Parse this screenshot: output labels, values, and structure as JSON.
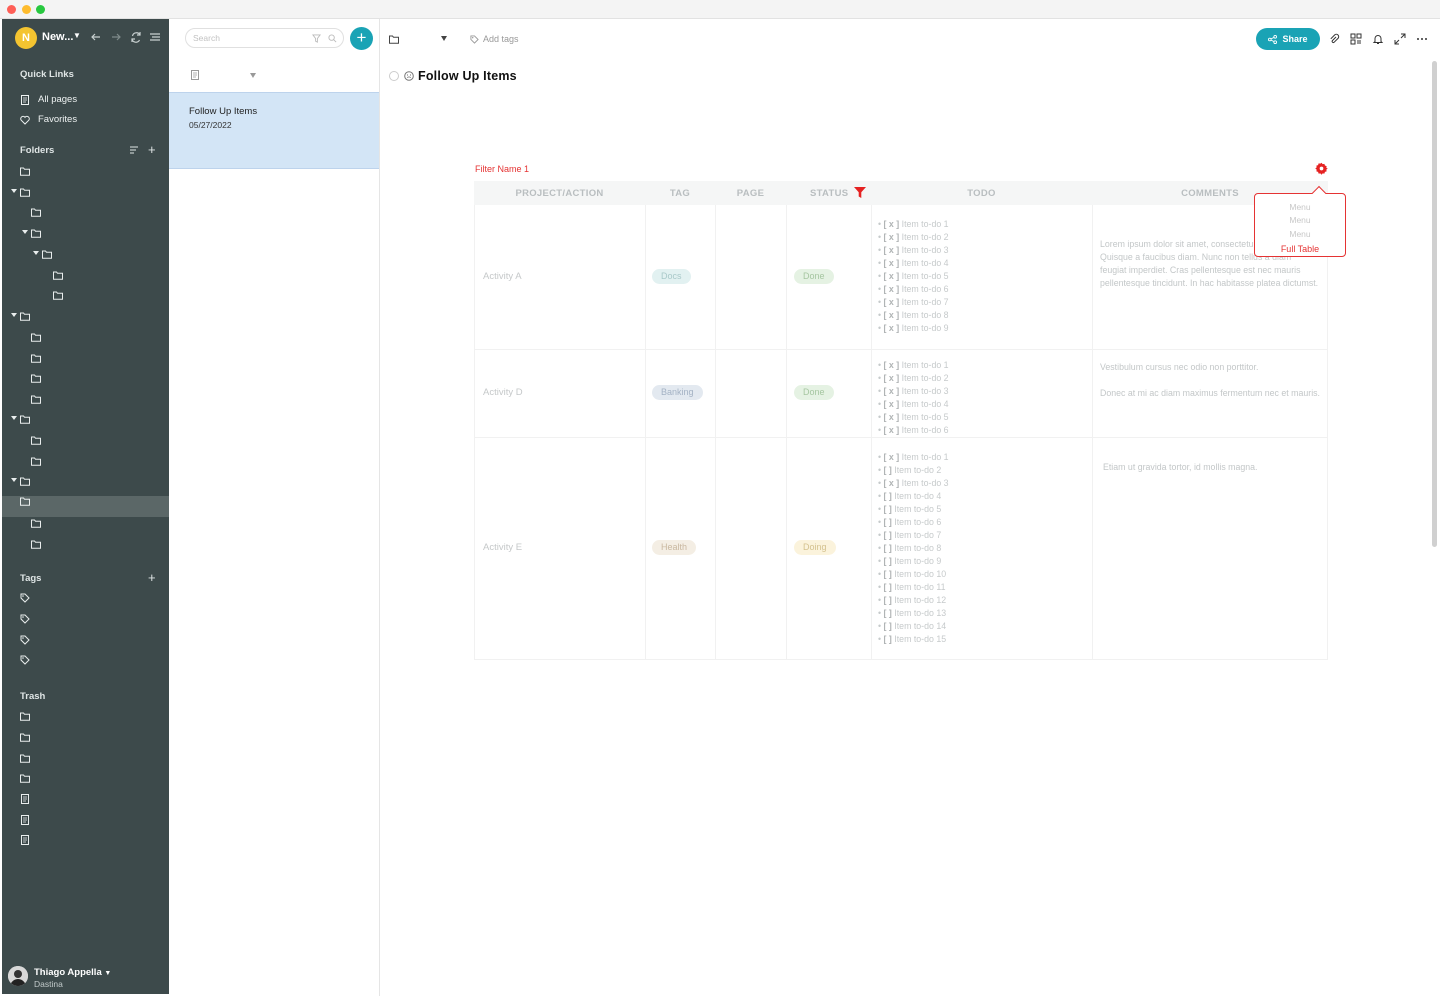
{
  "app": {
    "workspace_initial": "N",
    "workspace_name": "New...",
    "colors": {
      "sidebar": "#3d4a4b",
      "accent": "#1aa3b5",
      "selection": "#d3e5f6",
      "filter_red": "#e53333"
    }
  },
  "sidebar": {
    "quick_links_title": "Quick Links",
    "quick_links": [
      {
        "label": "All pages",
        "icon": "page-icon"
      },
      {
        "label": "Favorites",
        "icon": "heart-icon"
      }
    ],
    "folders_title": "Folders",
    "tags_title": "Tags",
    "trash_title": "Trash",
    "user_name": "Thiago Appella",
    "user_sub": "Dastina"
  },
  "list": {
    "search_placeholder": "Search",
    "note": {
      "title": "Follow Up Items",
      "date": "05/27/2022"
    }
  },
  "editor": {
    "add_tags": "Add tags",
    "share_label": "Share",
    "page_title": "Follow Up Items"
  },
  "table": {
    "filter_name": "Filter Name 1",
    "headers": [
      "PROJECT/ACTION",
      "TAG",
      "PAGE",
      "STATUS",
      "TODO",
      "COMMENTS"
    ],
    "rows": [
      {
        "action": "Activity A",
        "tag": "Docs",
        "status": "Done",
        "todos": [
          {
            "mark": "[ x ]",
            "text": "Item to-do 1"
          },
          {
            "mark": "[ x ]",
            "text": "Item to-do 2"
          },
          {
            "mark": "[ x ]",
            "text": "Item to-do 3"
          },
          {
            "mark": "[ x ]",
            "text": "Item to-do 4"
          },
          {
            "mark": "[ x ]",
            "text": "Item to-do 5"
          },
          {
            "mark": "[ x ]",
            "text": "Item to-do 6"
          },
          {
            "mark": "[ x ]",
            "text": "Item to-do 7"
          },
          {
            "mark": "[ x ]",
            "text": "Item to-do 8"
          },
          {
            "mark": "[ x ]",
            "text": "Item to-do 9"
          }
        ],
        "comments": [
          "Lorem ipsum dolor sit amet, consectetur adipiscing elit. Quisque a faucibus diam. Nunc non tellus a diam feugiat imperdiet. Cras pellentesque est nec mauris pellentesque tincidunt. In hac habitasse platea dictumst."
        ]
      },
      {
        "action": "Activity D",
        "tag": "Banking",
        "status": "Done",
        "todos": [
          {
            "mark": "[ x ]",
            "text": "Item to-do 1"
          },
          {
            "mark": "[ x ]",
            "text": "Item to-do 2"
          },
          {
            "mark": "[ x ]",
            "text": "Item to-do 3"
          },
          {
            "mark": "[ x ]",
            "text": "Item to-do 4"
          },
          {
            "mark": "[ x ]",
            "text": "Item to-do 5"
          },
          {
            "mark": "[ x ]",
            "text": "Item to-do 6"
          }
        ],
        "comments": [
          "Vestibulum cursus nec odio non porttitor.",
          "Donec at mi ac diam maximus fermentum nec et mauris."
        ]
      },
      {
        "action": "Activity E",
        "tag": "Health",
        "status": "Doing",
        "todos": [
          {
            "mark": "[ x ]",
            "text": "Item to-do 1"
          },
          {
            "mark": "[   ]",
            "text": "Item to-do 2"
          },
          {
            "mark": "[ x ]",
            "text": "Item to-do 3"
          },
          {
            "mark": "[   ]",
            "text": "Item to-do 4"
          },
          {
            "mark": "[   ]",
            "text": "Item to-do 5"
          },
          {
            "mark": "[   ]",
            "text": "Item to-do 6"
          },
          {
            "mark": "[   ]",
            "text": "Item to-do 7"
          },
          {
            "mark": "[   ]",
            "text": "Item to-do 8"
          },
          {
            "mark": "[   ]",
            "text": "Item to-do 9"
          },
          {
            "mark": "[   ]",
            "text": "Item to-do 10"
          },
          {
            "mark": "[   ]",
            "text": "Item to-do 11"
          },
          {
            "mark": "[   ]",
            "text": "Item to-do 12"
          },
          {
            "mark": "[   ]",
            "text": "Item to-do 13"
          },
          {
            "mark": "[   ]",
            "text": "Item to-do 14"
          },
          {
            "mark": "[   ]",
            "text": "Item to-do 15"
          }
        ],
        "comments": [
          "Etiam ut gravida tortor, id mollis magna."
        ]
      }
    ],
    "menu": [
      "Menu",
      "Menu",
      "Menu"
    ],
    "menu_full": "Full Table"
  }
}
